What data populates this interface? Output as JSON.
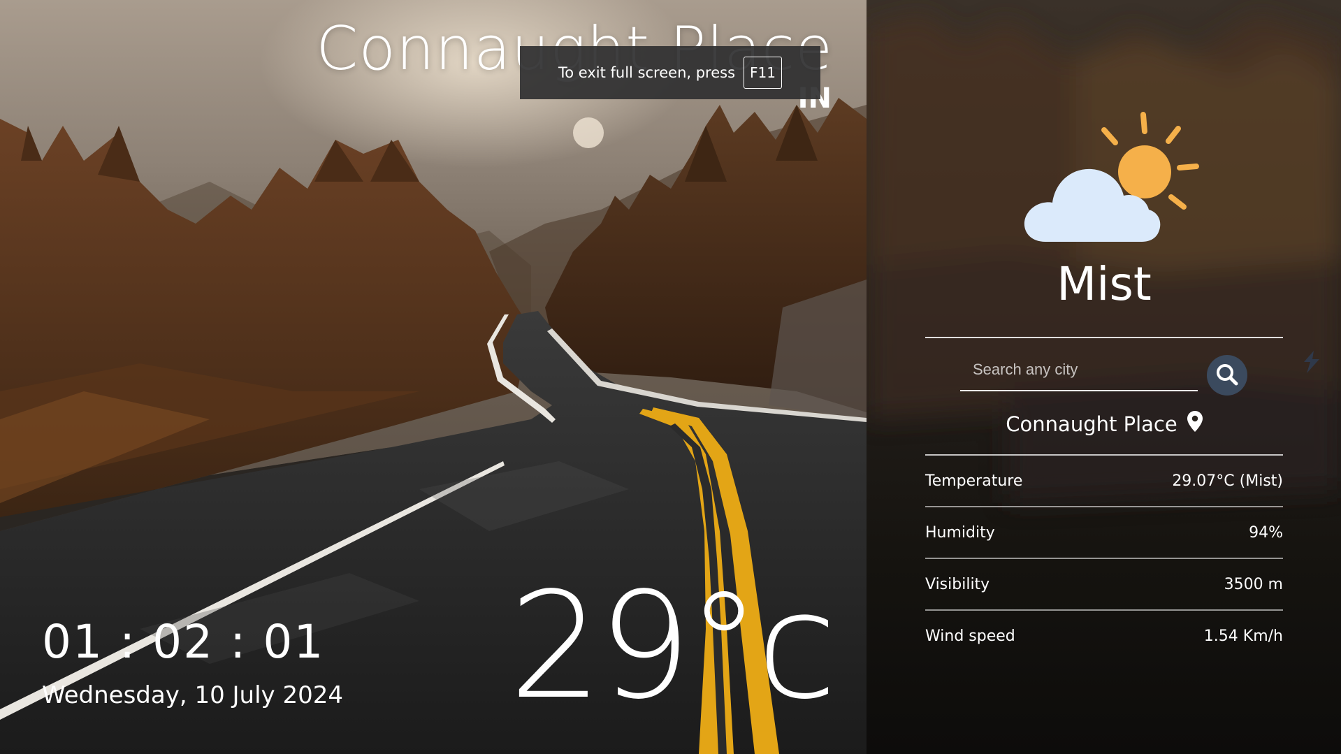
{
  "header": {
    "city_title": "Connaught Place",
    "country_code": "IN"
  },
  "fullscreen_toast": {
    "message": "To exit full screen, press",
    "key": "F11"
  },
  "clock": {
    "time": "01 : 02 : 01",
    "date": "Wednesday, 10 July 2024"
  },
  "current": {
    "temperature_display": "29°c"
  },
  "panel": {
    "weather_icon": "partly-cloudy-icon",
    "condition": "Mist",
    "search": {
      "placeholder": "Search any city",
      "value": "",
      "button_icon": "search-icon"
    },
    "location": {
      "name": "Connaught Place",
      "icon": "location-pin-icon"
    },
    "stats": [
      {
        "label": "Temperature",
        "value": "29.07°C (Mist)"
      },
      {
        "label": "Humidity",
        "value": "94%"
      },
      {
        "label": "Visibility",
        "value": "3500 m"
      },
      {
        "label": "Wind speed",
        "value": "1.54 Km/h"
      }
    ]
  },
  "colors": {
    "sun": "#f5b04a",
    "cloud": "#dbeafb",
    "search_button": "#3b4a5e",
    "road_line_yellow": "#e3a516"
  }
}
